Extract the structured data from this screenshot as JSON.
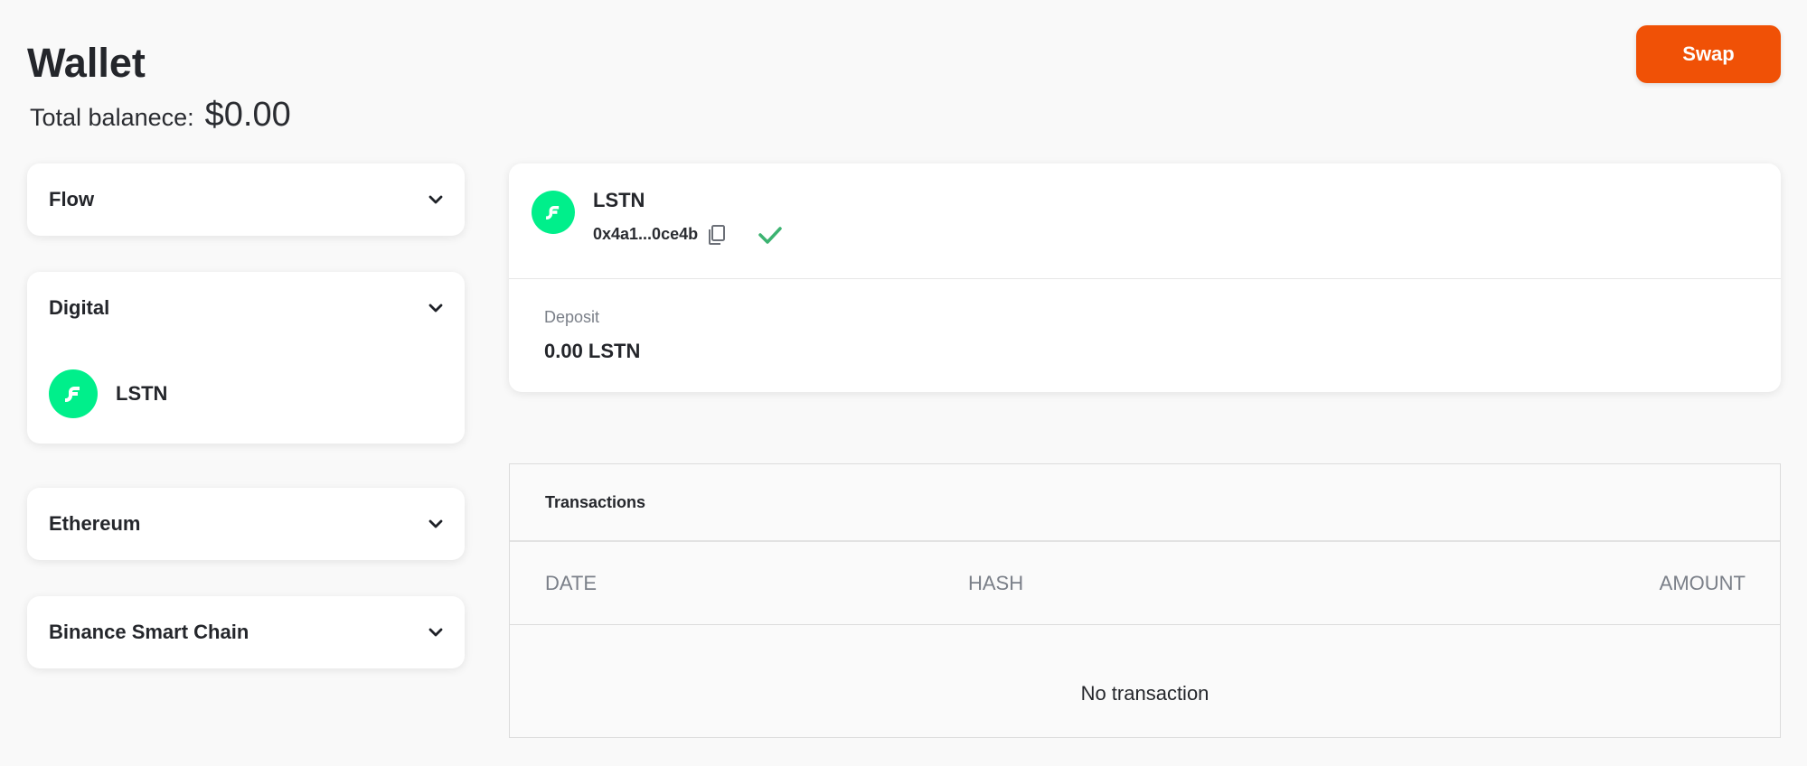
{
  "header": {
    "title": "Wallet",
    "balance_label": "Total balanece:",
    "balance_value": "$0.00",
    "swap_label": "Swap"
  },
  "sidebar": {
    "chains": [
      {
        "name": "Flow",
        "expanded": false
      },
      {
        "name": "Digital",
        "expanded": true,
        "tokens": [
          {
            "name": "LSTN",
            "icon": "flow-logo-icon"
          }
        ]
      },
      {
        "name": "Ethereum",
        "expanded": false
      },
      {
        "name": "Binance Smart Chain",
        "expanded": false
      }
    ]
  },
  "token_detail": {
    "symbol": "LSTN",
    "address": "0x4a1...0ce4b",
    "deposit_label": "Deposit",
    "deposit_value": "0.00 LSTN"
  },
  "transactions": {
    "title": "Transactions",
    "columns": [
      "DATE",
      "HASH",
      "AMOUNT"
    ],
    "empty_text": "No transaction"
  },
  "colors": {
    "accent": "#f05106",
    "token_logo": "#00ef8b",
    "check": "#3cb371"
  }
}
